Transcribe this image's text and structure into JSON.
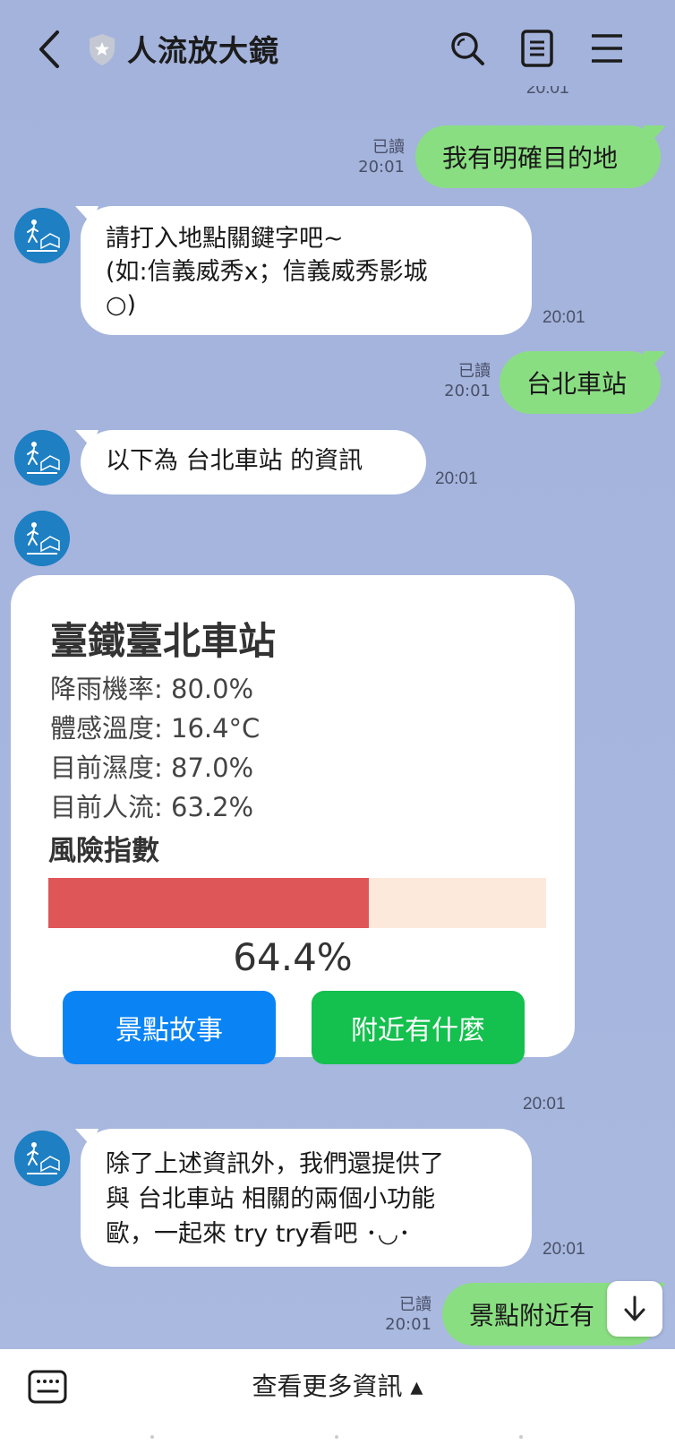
{
  "header": {
    "title": "人流放大鏡",
    "icons": [
      "back-icon",
      "shield-icon",
      "search-icon",
      "notes-icon",
      "menu-icon"
    ]
  },
  "messages": {
    "top_partial_time": "20:01",
    "m1": {
      "text": "我有明確目的地",
      "read": "已讀",
      "time": "20:01"
    },
    "b1": {
      "line1": "請打入地點關鍵字吧~",
      "line2": "(如:信義威秀x；信義威秀影城",
      "line3": "○)",
      "time": "20:01"
    },
    "m2": {
      "text": "台北車站",
      "read": "已讀",
      "time": "20:01"
    },
    "b2": {
      "text": "以下為 台北車站 的資訊",
      "time": "20:01"
    },
    "card_time": "20:01",
    "b3": {
      "line1": "除了上述資訊外，我們還提供了",
      "line2": "與 台北車站 相關的兩個小功能",
      "line3": "歐，一起來 try try看吧 ･◡･",
      "time": "20:01"
    },
    "m3": {
      "text": "景點附近有",
      "read": "已讀",
      "time": "20:01"
    }
  },
  "card": {
    "title": "臺鐵臺北車站",
    "rain": "降雨機率: 80.0%",
    "feels": "體感溫度: 16.4°C",
    "humidity": "目前濕度: 87.0%",
    "crowd": "目前人流: 63.2%",
    "risk_label": "風險指數",
    "risk_value": 0.644,
    "risk_text": "64.4%",
    "btn_story": "景點故事",
    "btn_nearby": "附近有什麼",
    "colors": {
      "bar_fill": "#df5658",
      "bar_track": "#fde9dc",
      "btn_story": "#0a84f5",
      "btn_nearby": "#14c04e"
    }
  },
  "bottom": {
    "more_info": "查看更多資訊 ▴"
  }
}
